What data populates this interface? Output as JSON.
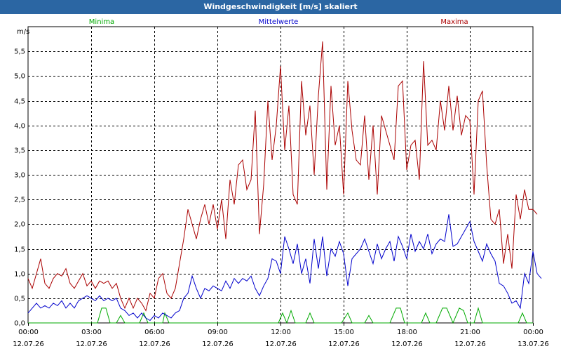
{
  "window": {
    "title": "Windgeschwindigkeit [m/s] skaliert"
  },
  "chart_data": {
    "type": "line",
    "title": "Windgeschwindigkeit [m/s] skaliert",
    "ylabel": "m/s",
    "ylim": [
      0,
      6
    ],
    "yticks": [
      "0,0",
      "0,5",
      "1,0",
      "1,5",
      "2,0",
      "2,5",
      "3,0",
      "3,5",
      "4,0",
      "4,5",
      "5,0",
      "5,5"
    ],
    "ytick_values": [
      0,
      0.5,
      1,
      1.5,
      2,
      2.5,
      3,
      3.5,
      4,
      4.5,
      5,
      5.5
    ],
    "xlim": [
      0,
      24
    ],
    "xticks": [
      {
        "hour": 0,
        "time": "00:00",
        "date": "12.07.26"
      },
      {
        "hour": 3,
        "time": "03:00",
        "date": "12.07.26"
      },
      {
        "hour": 6,
        "time": "06:00",
        "date": "12.07.26"
      },
      {
        "hour": 9,
        "time": "09:00",
        "date": "12.07.26"
      },
      {
        "hour": 12,
        "time": "12:00",
        "date": "12.07.26"
      },
      {
        "hour": 15,
        "time": "15:00",
        "date": "12.07.26"
      },
      {
        "hour": 18,
        "time": "18:00",
        "date": "12.07.26"
      },
      {
        "hour": 21,
        "time": "21:00",
        "date": "12.07.26"
      },
      {
        "hour": 24,
        "time": "00:00",
        "date": "13.07.26"
      }
    ],
    "grid": true,
    "legend_position": "top",
    "series": [
      {
        "name": "Minima",
        "color": "#00aa00",
        "points": [
          [
            0,
            0
          ],
          [
            3.3,
            0
          ],
          [
            3.5,
            0.3
          ],
          [
            3.7,
            0.3
          ],
          [
            3.9,
            0
          ],
          [
            4.2,
            0
          ],
          [
            4.4,
            0.15
          ],
          [
            4.6,
            0
          ],
          [
            5.3,
            0
          ],
          [
            5.5,
            0.2
          ],
          [
            5.7,
            0
          ],
          [
            6.4,
            0
          ],
          [
            6.5,
            0.2
          ],
          [
            6.7,
            0
          ],
          [
            11.9,
            0
          ],
          [
            12.1,
            0.2
          ],
          [
            12.3,
            0
          ],
          [
            12.5,
            0.25
          ],
          [
            12.7,
            0
          ],
          [
            13.2,
            0
          ],
          [
            13.4,
            0.2
          ],
          [
            13.6,
            0
          ],
          [
            14.9,
            0
          ],
          [
            15.2,
            0.2
          ],
          [
            15.4,
            0
          ],
          [
            16.0,
            0
          ],
          [
            16.2,
            0.15
          ],
          [
            16.4,
            0
          ],
          [
            17.2,
            0
          ],
          [
            17.5,
            0.3
          ],
          [
            17.7,
            0.3
          ],
          [
            17.9,
            0
          ],
          [
            18.7,
            0
          ],
          [
            18.9,
            0.2
          ],
          [
            19.1,
            0
          ],
          [
            19.4,
            0
          ],
          [
            19.7,
            0.3
          ],
          [
            19.9,
            0.3
          ],
          [
            20.2,
            0
          ],
          [
            20.5,
            0.3
          ],
          [
            20.7,
            0.25
          ],
          [
            20.9,
            0
          ],
          [
            21.2,
            0
          ],
          [
            21.4,
            0.3
          ],
          [
            21.6,
            0
          ],
          [
            23.3,
            0
          ],
          [
            23.5,
            0.2
          ],
          [
            23.7,
            0
          ],
          [
            24,
            0
          ]
        ]
      },
      {
        "name": "Mittelwerte",
        "color": "#0000cc",
        "points": [
          [
            0,
            0.2
          ],
          [
            0.2,
            0.3
          ],
          [
            0.4,
            0.4
          ],
          [
            0.6,
            0.3
          ],
          [
            0.8,
            0.35
          ],
          [
            1.0,
            0.3
          ],
          [
            1.2,
            0.4
          ],
          [
            1.4,
            0.35
          ],
          [
            1.6,
            0.45
          ],
          [
            1.8,
            0.3
          ],
          [
            2.0,
            0.4
          ],
          [
            2.2,
            0.3
          ],
          [
            2.4,
            0.45
          ],
          [
            2.6,
            0.5
          ],
          [
            2.8,
            0.55
          ],
          [
            3.0,
            0.5
          ],
          [
            3.2,
            0.45
          ],
          [
            3.4,
            0.55
          ],
          [
            3.6,
            0.45
          ],
          [
            3.8,
            0.5
          ],
          [
            4.0,
            0.45
          ],
          [
            4.2,
            0.5
          ],
          [
            4.4,
            0.3
          ],
          [
            4.6,
            0.25
          ],
          [
            4.8,
            0.15
          ],
          [
            5.0,
            0.2
          ],
          [
            5.2,
            0.1
          ],
          [
            5.4,
            0.2
          ],
          [
            5.6,
            0.1
          ],
          [
            5.8,
            0.05
          ],
          [
            6.0,
            0.15
          ],
          [
            6.2,
            0.1
          ],
          [
            6.4,
            0.2
          ],
          [
            6.6,
            0.15
          ],
          [
            6.8,
            0.1
          ],
          [
            7.0,
            0.2
          ],
          [
            7.2,
            0.25
          ],
          [
            7.4,
            0.5
          ],
          [
            7.6,
            0.6
          ],
          [
            7.8,
            0.95
          ],
          [
            8.0,
            0.7
          ],
          [
            8.2,
            0.5
          ],
          [
            8.4,
            0.7
          ],
          [
            8.6,
            0.65
          ],
          [
            8.8,
            0.75
          ],
          [
            9.0,
            0.7
          ],
          [
            9.2,
            0.65
          ],
          [
            9.4,
            0.85
          ],
          [
            9.6,
            0.7
          ],
          [
            9.8,
            0.9
          ],
          [
            10.0,
            0.8
          ],
          [
            10.2,
            0.9
          ],
          [
            10.4,
            0.85
          ],
          [
            10.6,
            0.95
          ],
          [
            10.8,
            0.7
          ],
          [
            11.0,
            0.55
          ],
          [
            11.2,
            0.75
          ],
          [
            11.4,
            0.9
          ],
          [
            11.6,
            1.3
          ],
          [
            11.8,
            1.25
          ],
          [
            12.0,
            1.0
          ],
          [
            12.2,
            1.75
          ],
          [
            12.4,
            1.5
          ],
          [
            12.6,
            1.2
          ],
          [
            12.8,
            1.6
          ],
          [
            13.0,
            1.0
          ],
          [
            13.2,
            1.3
          ],
          [
            13.4,
            0.8
          ],
          [
            13.6,
            1.7
          ],
          [
            13.8,
            1.1
          ],
          [
            14.0,
            1.75
          ],
          [
            14.2,
            0.95
          ],
          [
            14.4,
            1.5
          ],
          [
            14.6,
            1.35
          ],
          [
            14.8,
            1.65
          ],
          [
            15.0,
            1.4
          ],
          [
            15.2,
            0.75
          ],
          [
            15.4,
            1.3
          ],
          [
            15.6,
            1.4
          ],
          [
            15.8,
            1.5
          ],
          [
            16.0,
            1.7
          ],
          [
            16.2,
            1.45
          ],
          [
            16.4,
            1.2
          ],
          [
            16.6,
            1.6
          ],
          [
            16.8,
            1.3
          ],
          [
            17.0,
            1.5
          ],
          [
            17.2,
            1.65
          ],
          [
            17.4,
            1.25
          ],
          [
            17.6,
            1.75
          ],
          [
            17.8,
            1.55
          ],
          [
            18.0,
            1.3
          ],
          [
            18.2,
            1.8
          ],
          [
            18.4,
            1.45
          ],
          [
            18.6,
            1.65
          ],
          [
            18.8,
            1.5
          ],
          [
            19.0,
            1.8
          ],
          [
            19.2,
            1.4
          ],
          [
            19.4,
            1.6
          ],
          [
            19.6,
            1.7
          ],
          [
            19.8,
            1.65
          ],
          [
            20.0,
            2.2
          ],
          [
            20.2,
            1.55
          ],
          [
            20.4,
            1.6
          ],
          [
            20.6,
            1.75
          ],
          [
            20.8,
            1.9
          ],
          [
            21.0,
            2.05
          ],
          [
            21.2,
            1.65
          ],
          [
            21.4,
            1.45
          ],
          [
            21.6,
            1.25
          ],
          [
            21.8,
            1.6
          ],
          [
            22.0,
            1.4
          ],
          [
            22.2,
            1.25
          ],
          [
            22.4,
            0.8
          ],
          [
            22.6,
            0.75
          ],
          [
            22.8,
            0.6
          ],
          [
            23.0,
            0.4
          ],
          [
            23.2,
            0.45
          ],
          [
            23.4,
            0.3
          ],
          [
            23.6,
            1.0
          ],
          [
            23.8,
            0.8
          ],
          [
            24.0,
            1.45
          ],
          [
            24.2,
            1.0
          ],
          [
            24.4,
            0.9
          ]
        ]
      },
      {
        "name": "Maxima",
        "color": "#aa0000",
        "points": [
          [
            0,
            0.9
          ],
          [
            0.2,
            0.7
          ],
          [
            0.4,
            1.0
          ],
          [
            0.6,
            1.3
          ],
          [
            0.8,
            0.8
          ],
          [
            1.0,
            0.7
          ],
          [
            1.2,
            0.9
          ],
          [
            1.4,
            1.0
          ],
          [
            1.6,
            0.95
          ],
          [
            1.8,
            1.1
          ],
          [
            2.0,
            0.8
          ],
          [
            2.2,
            0.7
          ],
          [
            2.4,
            0.85
          ],
          [
            2.6,
            1.0
          ],
          [
            2.8,
            0.75
          ],
          [
            3.0,
            0.85
          ],
          [
            3.2,
            0.7
          ],
          [
            3.4,
            0.85
          ],
          [
            3.6,
            0.8
          ],
          [
            3.8,
            0.85
          ],
          [
            4.0,
            0.7
          ],
          [
            4.2,
            0.8
          ],
          [
            4.4,
            0.5
          ],
          [
            4.6,
            0.3
          ],
          [
            4.8,
            0.5
          ],
          [
            5.0,
            0.3
          ],
          [
            5.2,
            0.5
          ],
          [
            5.4,
            0.4
          ],
          [
            5.6,
            0.25
          ],
          [
            5.8,
            0.6
          ],
          [
            6.0,
            0.5
          ],
          [
            6.2,
            0.9
          ],
          [
            6.4,
            1.0
          ],
          [
            6.6,
            0.6
          ],
          [
            6.8,
            0.5
          ],
          [
            7.0,
            0.7
          ],
          [
            7.2,
            1.2
          ],
          [
            7.4,
            1.7
          ],
          [
            7.6,
            2.3
          ],
          [
            7.8,
            2.0
          ],
          [
            8.0,
            1.7
          ],
          [
            8.2,
            2.1
          ],
          [
            8.4,
            2.4
          ],
          [
            8.6,
            2.0
          ],
          [
            8.8,
            2.4
          ],
          [
            9.0,
            1.9
          ],
          [
            9.2,
            2.5
          ],
          [
            9.4,
            1.7
          ],
          [
            9.6,
            2.9
          ],
          [
            9.8,
            2.4
          ],
          [
            10.0,
            3.2
          ],
          [
            10.2,
            3.3
          ],
          [
            10.4,
            2.7
          ],
          [
            10.6,
            2.9
          ],
          [
            10.8,
            4.3
          ],
          [
            11.0,
            1.8
          ],
          [
            11.2,
            2.8
          ],
          [
            11.4,
            4.5
          ],
          [
            11.6,
            3.3
          ],
          [
            11.8,
            4.0
          ],
          [
            12.0,
            5.2
          ],
          [
            12.2,
            3.5
          ],
          [
            12.4,
            4.4
          ],
          [
            12.6,
            2.6
          ],
          [
            12.8,
            2.4
          ],
          [
            13.0,
            4.9
          ],
          [
            13.2,
            3.8
          ],
          [
            13.4,
            4.4
          ],
          [
            13.6,
            3.0
          ],
          [
            13.8,
            4.6
          ],
          [
            14.0,
            5.7
          ],
          [
            14.2,
            2.7
          ],
          [
            14.4,
            4.8
          ],
          [
            14.6,
            3.6
          ],
          [
            14.8,
            4.0
          ],
          [
            15.0,
            2.6
          ],
          [
            15.2,
            4.9
          ],
          [
            15.4,
            3.9
          ],
          [
            15.6,
            3.3
          ],
          [
            15.8,
            3.2
          ],
          [
            16.0,
            4.2
          ],
          [
            16.2,
            2.9
          ],
          [
            16.4,
            4.0
          ],
          [
            16.6,
            2.6
          ],
          [
            16.8,
            4.2
          ],
          [
            17.0,
            3.9
          ],
          [
            17.2,
            3.6
          ],
          [
            17.4,
            3.3
          ],
          [
            17.6,
            4.8
          ],
          [
            17.8,
            4.9
          ],
          [
            18.0,
            3.1
          ],
          [
            18.2,
            3.6
          ],
          [
            18.4,
            3.7
          ],
          [
            18.6,
            2.9
          ],
          [
            18.8,
            5.3
          ],
          [
            19.0,
            3.6
          ],
          [
            19.2,
            3.7
          ],
          [
            19.4,
            3.5
          ],
          [
            19.6,
            4.5
          ],
          [
            19.8,
            3.9
          ],
          [
            20.0,
            4.8
          ],
          [
            20.2,
            3.9
          ],
          [
            20.4,
            4.6
          ],
          [
            20.6,
            3.8
          ],
          [
            20.8,
            4.2
          ],
          [
            21.0,
            4.1
          ],
          [
            21.2,
            2.6
          ],
          [
            21.4,
            4.5
          ],
          [
            21.6,
            4.7
          ],
          [
            21.8,
            3.2
          ],
          [
            22.0,
            2.1
          ],
          [
            22.2,
            2.0
          ],
          [
            22.4,
            2.3
          ],
          [
            22.6,
            1.2
          ],
          [
            22.8,
            1.8
          ],
          [
            23.0,
            1.1
          ],
          [
            23.2,
            2.6
          ],
          [
            23.4,
            2.1
          ],
          [
            23.6,
            2.7
          ],
          [
            23.8,
            2.3
          ],
          [
            24.0,
            2.3
          ],
          [
            24.2,
            2.2
          ]
        ]
      }
    ]
  }
}
